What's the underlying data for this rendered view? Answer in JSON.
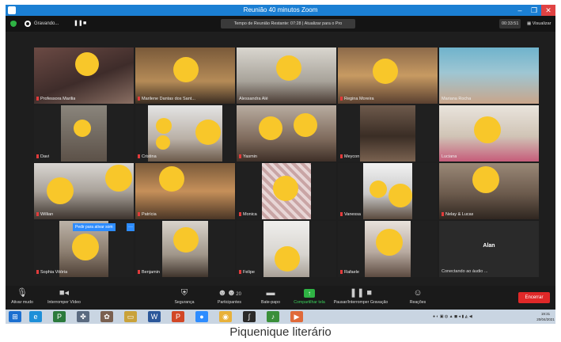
{
  "window": {
    "title": "Reunião 40 minutos Zoom",
    "minimize": "–",
    "maximize": "❐",
    "close": "✕"
  },
  "topbar": {
    "recording": "Gravando...",
    "pause": "❚❚",
    "stop": "■",
    "time_banner": "Tempo de Reunião Restante: 07:28 | Atualizar para o Pro",
    "clock": "00:33:51",
    "view_label": "Visualizar"
  },
  "tooltip": {
    "text": "Pedir para ativar som",
    "more": "···"
  },
  "participants": [
    {
      "name": "Professora Marilia"
    },
    {
      "name": "Marilene Dantas dos Sant..."
    },
    {
      "name": "Alessandra Alé"
    },
    {
      "name": "Regina Moreira"
    },
    {
      "name": "Mariana Rocha"
    },
    {
      "name": "Davi"
    },
    {
      "name": "Cristina"
    },
    {
      "name": "Yasmin"
    },
    {
      "name": "Meycon"
    },
    {
      "name": "Luciana"
    },
    {
      "name": "Willian"
    },
    {
      "name": "Patrícia"
    },
    {
      "name": "Monica"
    },
    {
      "name": "Vanessa"
    },
    {
      "name": "Nelay & Lucas"
    },
    {
      "name": "Sophia Vitória"
    },
    {
      "name": "Benjamin"
    },
    {
      "name": "Felipe"
    },
    {
      "name": "Rafaele"
    },
    {
      "name": "Alan",
      "status": "Conectando ao áudio ..."
    }
  ],
  "toolbar": {
    "mute": "Ativar mudo",
    "video": "Interromper Vídeo",
    "security": "Segurança",
    "participants": "Participantes",
    "participants_count": "20",
    "chat": "Bate-papo",
    "share": "Compartilhar tela",
    "record": "Pausar/Interromper Gravação",
    "reactions": "Reações",
    "end": "Encerrar"
  },
  "taskbar": {
    "time": "19:31",
    "date": "20/04/2021"
  },
  "caption": "Piquenique literário",
  "colors": {
    "titlebar": "#1b7fd3",
    "zoom_bg": "#1e1e1e",
    "active_border": "#c3d45a",
    "end_button": "#e02828",
    "share_green": "#2fb344",
    "emoji_face": "#f8c72a"
  }
}
